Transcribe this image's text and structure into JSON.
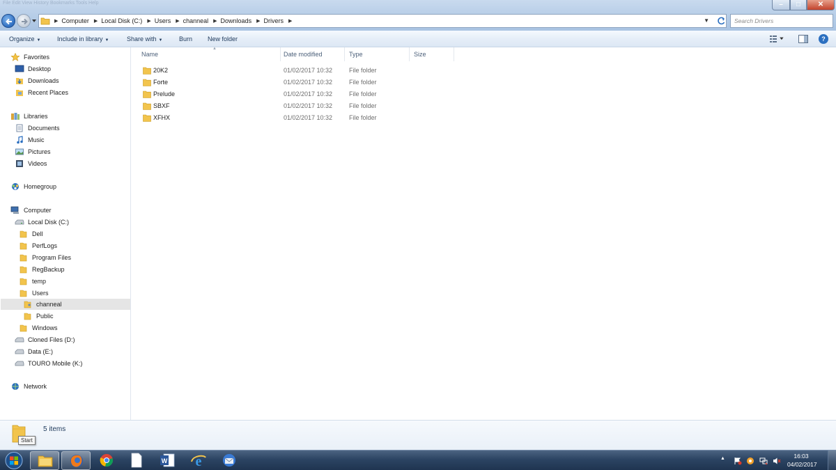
{
  "window": {
    "faint_menu": "File  Edit  View  History  Bookmarks  Tools  Help"
  },
  "address": {
    "breadcrumbs": [
      "Computer",
      "Local Disk (C:)",
      "Users",
      "channeal",
      "Downloads",
      "Drivers"
    ]
  },
  "search": {
    "placeholder": "Search Drivers"
  },
  "toolbar": {
    "organize": "Organize",
    "include_in_library": "Include in library",
    "share_with": "Share with",
    "burn": "Burn",
    "new_folder": "New folder"
  },
  "columns": {
    "name": "Name",
    "date_modified": "Date modified",
    "type": "Type",
    "size": "Size"
  },
  "files": [
    {
      "name": "20K2",
      "date": "01/02/2017 10:32",
      "type": "File folder"
    },
    {
      "name": "Forte",
      "date": "01/02/2017 10:32",
      "type": "File folder"
    },
    {
      "name": "Prelude",
      "date": "01/02/2017 10:32",
      "type": "File folder"
    },
    {
      "name": "SBXF",
      "date": "01/02/2017 10:32",
      "type": "File folder"
    },
    {
      "name": "XFHX",
      "date": "01/02/2017 10:32",
      "type": "File folder"
    }
  ],
  "nav": {
    "favorites": "Favorites",
    "desktop": "Desktop",
    "downloads": "Downloads",
    "recent_places": "Recent Places",
    "libraries": "Libraries",
    "documents": "Documents",
    "music": "Music",
    "pictures": "Pictures",
    "videos": "Videos",
    "homegroup": "Homegroup",
    "computer": "Computer",
    "local_disk": "Local Disk (C:)",
    "dell": "Dell",
    "perflogs": "PerfLogs",
    "program_files": "Program Files",
    "regbackup": "RegBackup",
    "temp": "temp",
    "users": "Users",
    "channeal": "channeal",
    "public": "Public",
    "windows": "Windows",
    "cloned_files": "Cloned Files (D:)",
    "data": "Data (E:)",
    "touro": "TOURO Mobile (K:)",
    "network": "Network"
  },
  "status": {
    "item_count": "5 items",
    "tooltip": "Start"
  },
  "clock": {
    "time": "16:03",
    "date": "04/02/2017"
  },
  "colors": {
    "accent": "#2b6fc0",
    "folder": "#f2c44d",
    "taskbar": "#2c4463"
  }
}
